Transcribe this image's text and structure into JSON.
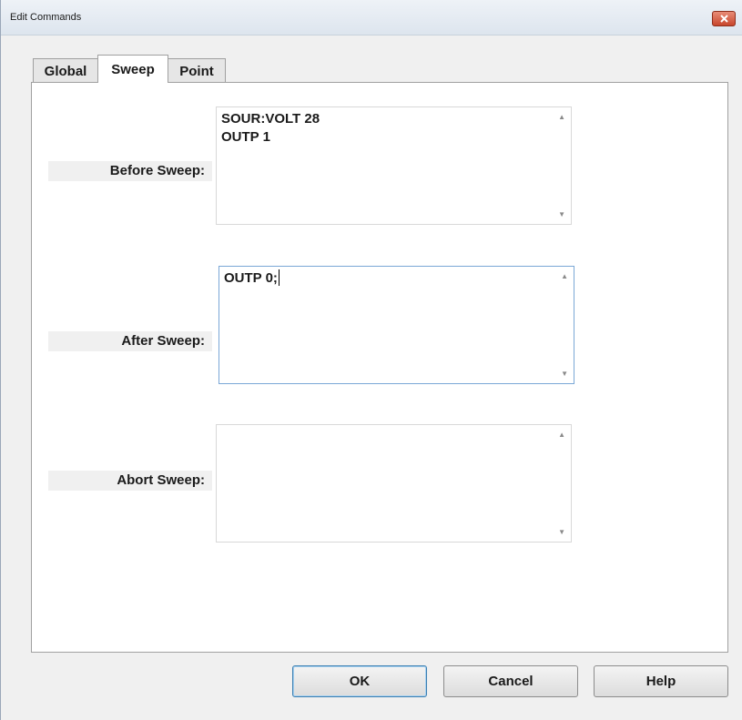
{
  "window": {
    "title": "Edit Commands",
    "close_icon": "close-icon"
  },
  "tabs": [
    {
      "label": "Global",
      "active": false
    },
    {
      "label": "Sweep",
      "active": true
    },
    {
      "label": "Point",
      "active": false
    }
  ],
  "fields": {
    "before_sweep": {
      "label": "Before Sweep:",
      "value": "SOUR:VOLT 28\nOUTP 1"
    },
    "after_sweep": {
      "label": "After Sweep:",
      "value": "OUTP 0;"
    },
    "abort_sweep": {
      "label": "Abort Sweep:",
      "value": ""
    }
  },
  "buttons": {
    "ok": "OK",
    "cancel": "Cancel",
    "help": "Help"
  },
  "colors": {
    "focus_border": "#7aa7d6",
    "close_button": "#c8462c"
  }
}
